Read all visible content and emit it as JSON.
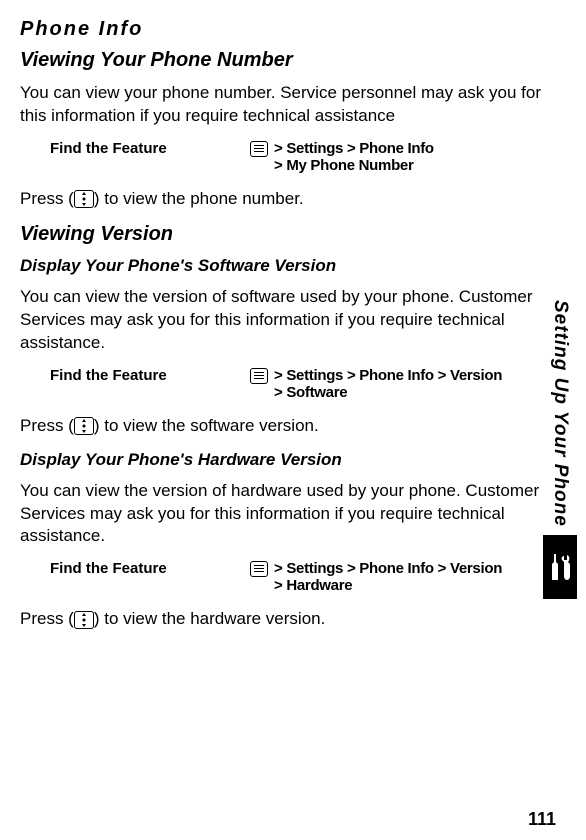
{
  "section": "Phone Info",
  "sub1": {
    "title": "Viewing Your Phone Number",
    "body": "You can view your phone number. Service personnel may ask you for this information if you require technical assistance",
    "find_label": "Find the Feature",
    "path_line1": "> Settings > Phone Info",
    "path_line2": "> My Phone Number",
    "press_before": "Press (",
    "press_after": ") to view the phone number."
  },
  "sub2": {
    "title": "Viewing Version",
    "dsv_title": "Display Your Phone's Software Version",
    "dsv_body": "You can view the version of software used by your phone. Customer Services may ask you for this information if you require technical assistance.",
    "dsv_find_label": "Find the Feature",
    "dsv_path_line1": "> Settings > Phone Info > Version",
    "dsv_path_line2": "> Software",
    "dsv_press_before": "Press (",
    "dsv_press_after": ") to view the software version.",
    "dhv_title": "Display Your Phone's Hardware Version",
    "dhv_body": "You can view the version of hardware used by your phone. Customer Services may ask you for this information if you require technical assistance.",
    "dhv_find_label": "Find the Feature",
    "dhv_path_line1": "> Settings > Phone Info > Version",
    "dhv_path_line2": "> Hardware",
    "dhv_press_before": "Press (",
    "dhv_press_after": ") to view the hardware version."
  },
  "sidebar_text": "Setting Up Your Phone",
  "page_number": "111"
}
